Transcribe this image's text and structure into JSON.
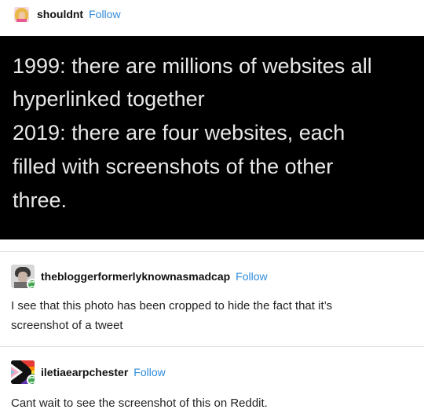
{
  "post": {
    "author": "shouldnt",
    "follow_label": "Follow",
    "image_lines": [
      "1999: there are millions of websites all",
      "hyperlinked together",
      "2019: there are four websites, each",
      "filled with screenshots of the other",
      "three."
    ]
  },
  "reblogs": [
    {
      "username": "thebloggerformerlyknownasmadcap",
      "follow_label": "Follow",
      "text_lines": [
        "I see that this photo has been cropped to hide the fact that it’s",
        "screenshot of a tweet"
      ]
    },
    {
      "username": "iletiaearpchester",
      "follow_label": "Follow",
      "text_lines": [
        "Cant wait to see the screenshot of this on Reddit."
      ]
    }
  ],
  "colors": {
    "follow": "#2f8bd9",
    "image_background": "#000000",
    "image_text": "#e8e8e8",
    "reblog_badge": "#3ea34b"
  }
}
